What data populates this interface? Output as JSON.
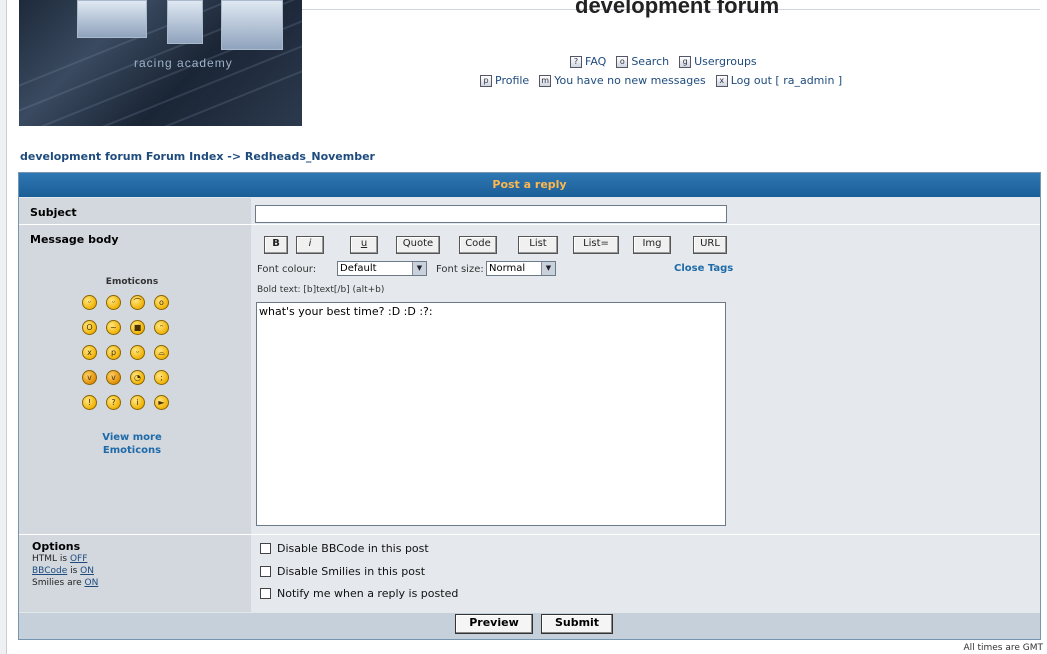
{
  "site": {
    "title": "development forum",
    "logo_tagline": "racing academy"
  },
  "nav": {
    "row1": [
      "FAQ",
      "Search",
      "Usergroups"
    ],
    "row2": [
      "Profile",
      "You have no new messages",
      "Log out [ ra_admin ]"
    ]
  },
  "breadcrumb": {
    "index": "development forum Forum Index",
    "sep": "->",
    "forum": "Redheads_November"
  },
  "form": {
    "header": "Post a reply",
    "subject_label": "Subject",
    "subject_value": "",
    "message_label": "Message body",
    "bbcode_buttons": [
      "B",
      "i",
      "u",
      "Quote",
      "Code",
      "List",
      "List=",
      "Img",
      "URL"
    ],
    "font_colour_label": "Font colour:",
    "font_colour_value": "Default",
    "font_size_label": "Font size:",
    "font_size_value": "Normal",
    "close_tags": "Close Tags",
    "hint": "Bold text: [b]text[/b]  (alt+b)",
    "message_value": "what's your best time?  :D  :D  :?:",
    "emoticons_title": "Emoticons",
    "emoticons": [
      ":D",
      ":)",
      ":(",
      ":o",
      ":shock:",
      ":?",
      "8)",
      ":lol:",
      ":x",
      ":P",
      ":oops:",
      ":cry:",
      ":evil:",
      ":twisted:",
      ":roll:",
      ":wink:",
      ":!:",
      ":?:",
      ":idea:",
      ":arrow:"
    ],
    "view_more": "View more Emoticons"
  },
  "options": {
    "label": "Options",
    "html": {
      "prefix": "HTML is ",
      "value": "OFF"
    },
    "bbcode": {
      "link": "BBCode",
      "mid": " is ",
      "value": "ON"
    },
    "smilies": {
      "prefix": "Smilies are ",
      "value": "ON"
    },
    "checkboxes": [
      "Disable BBCode in this post",
      "Disable Smilies in this post",
      "Notify me when a reply is posted"
    ]
  },
  "actions": {
    "preview": "Preview",
    "submit": "Submit"
  },
  "footer": {
    "times": "All times are GMT"
  }
}
